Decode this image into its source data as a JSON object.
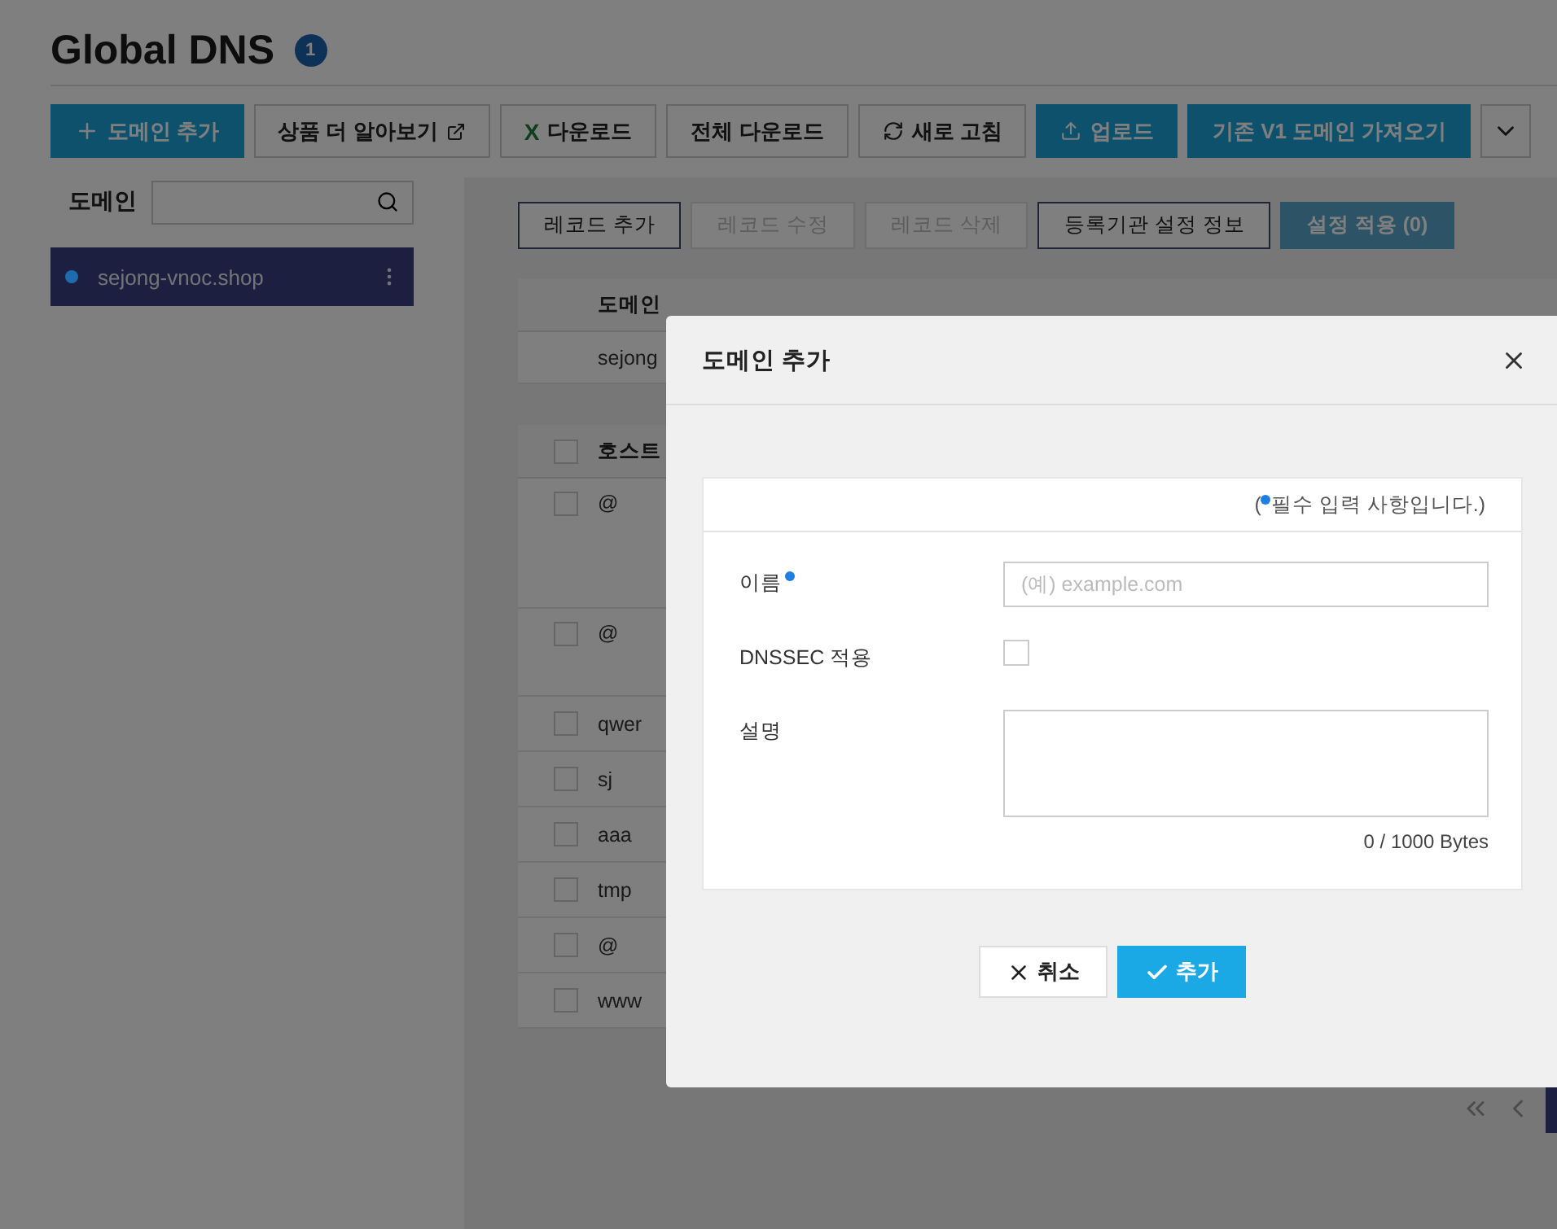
{
  "page": {
    "title": "Global DNS",
    "badge": "1"
  },
  "toolbar": [
    {
      "label": "도메인 추가",
      "kind": "primary"
    },
    {
      "label": "상품 더 알아보기",
      "kind": "default"
    },
    {
      "label": "다운로드",
      "kind": "default",
      "icon_text": "X"
    },
    {
      "label": "전체 다운로드",
      "kind": "default"
    },
    {
      "label": "새로 고침",
      "kind": "default"
    },
    {
      "label": "업로드",
      "kind": "primary"
    },
    {
      "label": "기존 V1 도메인 가져오기",
      "kind": "primary"
    },
    {
      "kind": "menu"
    }
  ],
  "sidebar": {
    "label": "도메인",
    "items": [
      {
        "name": "sejong-vnoc.shop",
        "selected": true,
        "color": "#1e6bb0"
      }
    ]
  },
  "record_buttons": [
    {
      "label": "레코드 추가",
      "kind": "outline",
      "disabled": false
    },
    {
      "label": "레코드 수정",
      "kind": "outline",
      "disabled": true
    },
    {
      "label": "레코드 삭제",
      "kind": "outline",
      "disabled": true
    },
    {
      "label": "등록기관 설정 정보",
      "kind": "outline",
      "disabled": false
    },
    {
      "label": "설정 적용 (0)",
      "kind": "primary",
      "disabled": true
    }
  ],
  "domain_table": {
    "header": "도메인",
    "rows": [
      "sejong"
    ]
  },
  "record_table": {
    "header": "호스트",
    "all_checked": false,
    "rows": [
      {
        "host": "@",
        "tall": true,
        "checked": false
      },
      {
        "host": "@",
        "tall": true,
        "checked": false
      },
      {
        "host": "qwer",
        "tall": false,
        "checked": false
      },
      {
        "host": "sj",
        "tall": false,
        "checked": false
      },
      {
        "host": "aaa",
        "tall": false,
        "checked": false
      },
      {
        "host": "tmp",
        "tall": false,
        "checked": false
      },
      {
        "host": "@",
        "tall": false,
        "checked": false
      },
      {
        "host": "www",
        "tall": false,
        "checked": false
      }
    ]
  },
  "dialog": {
    "title": "도메인 추가",
    "notice": {
      "open": "(",
      "text": "필수 입력 사항입니다.)"
    },
    "fields": [
      {
        "label": "이름",
        "kind": "input",
        "required": true,
        "placeholder": "(예) example.com"
      },
      {
        "label": "DNSSEC 적용",
        "kind": "checkbox",
        "required": false,
        "checked": false
      },
      {
        "label": "설명",
        "kind": "textarea",
        "required": false,
        "counter": "0 / 1000 Bytes"
      }
    ],
    "buttons": [
      {
        "label": "취소",
        "kind": "cancel"
      },
      {
        "label": "추가",
        "kind": "confirm"
      }
    ]
  }
}
